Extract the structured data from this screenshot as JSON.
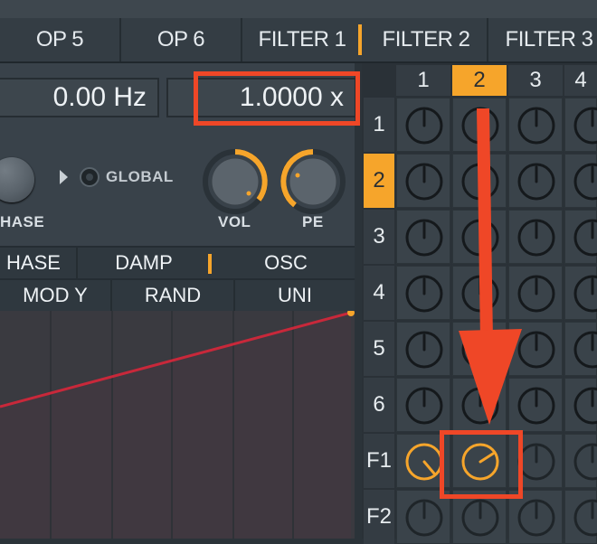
{
  "tabs": [
    {
      "label": "OP 5"
    },
    {
      "label": "OP 6"
    },
    {
      "label": "FILTER 1"
    },
    {
      "label": "FILTER 2"
    },
    {
      "label": "FILTER 3"
    }
  ],
  "fields": {
    "frequency": "0.00 Hz",
    "multiplier": "1.0000  x"
  },
  "knobs": {
    "phase_label": "HASE",
    "global_label": "GLOBAL",
    "vol_label": "VOL",
    "pe_label": "PE"
  },
  "row1_tabs": [
    "HASE",
    "DAMP",
    "OSC"
  ],
  "row2_tabs": [
    "MOD Y",
    "RAND",
    "UNI"
  ],
  "matrix": {
    "columns": [
      "1",
      "2",
      "3",
      "4"
    ],
    "rows": [
      "1",
      "2",
      "3",
      "4",
      "5",
      "6",
      "F1",
      "F2"
    ],
    "selected_column": "2",
    "selected_row": "2"
  },
  "colors": {
    "accent": "#f6a52b",
    "highlight": "#ef4727",
    "envelope_line": "#c8283a"
  }
}
